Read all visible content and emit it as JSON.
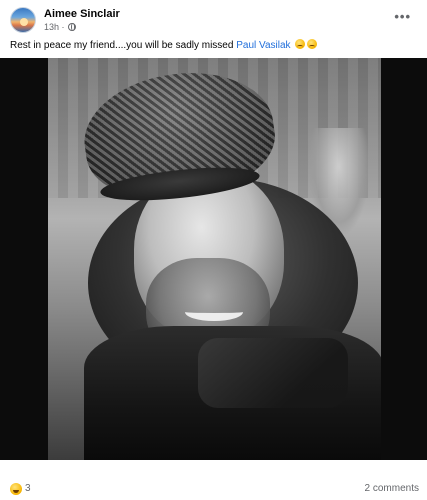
{
  "post": {
    "author": "Aimee Sinclair",
    "time": "13h",
    "meta_separator": " · ",
    "caption_text": "Rest in peace my friend....you will be sadly missed ",
    "mention": "Paul Vasilak",
    "reactions_count": "3",
    "comments_text": "2 comments",
    "icons": {
      "more": "more-options-icon",
      "privacy": "globe-icon",
      "emoji_1": "sad-face-emoji-icon",
      "emoji_2": "sad-face-emoji-icon",
      "reaction": "reaction-emoji-icon"
    }
  },
  "colors": {
    "mention_blue": "#216fdb",
    "meta_gray": "#65676b",
    "photo_bg": "#0c0c0c"
  }
}
